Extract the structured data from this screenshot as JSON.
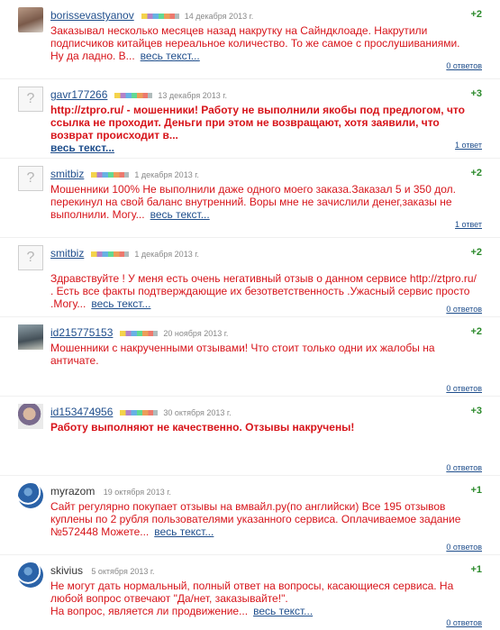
{
  "reviews": [
    {
      "author": "borissevastyanov",
      "date": "14 декабря 2013 г.",
      "score": "+2",
      "text": "Заказывал несколько месяцев назад накрутку на Сайндклоаде. Накрутили подписчиков китайцев нереальное количество. То же самое с прослушиваниями.",
      "text2": "Ну да ладно. В...",
      "more": "весь текст...",
      "answers": "0 ответов"
    },
    {
      "author": "gavr177266",
      "date": "13 декабря 2013 г.",
      "score": "+3",
      "text": "http://ztpro.ru/ - мошенники! Работу не выполнили якобы под предлогом, что ссылка не проходит. Деньги при этом не возвращают, хотя заявили, что возврат происходит в...",
      "more": "весь текст...",
      "answers": "1 ответ"
    },
    {
      "author": "smitbiz",
      "date": "1 декабря 2013 г.",
      "score": "+2",
      "text": "Мошенники 100% Не выполнили даже одного моего заказа.Заказал 5 и 350 дол. перекинул на свой баланс внутренний. Воры мне не зачислили денег,заказы не выполнили. Могу...",
      "more": "весь текст...",
      "answers": "1 ответ"
    },
    {
      "author": "smitbiz",
      "date": "1 декабря 2013 г.",
      "score": "+2",
      "text": "Здравствуйте ! У меня есть очень негативный отзыв о данном сервисе http://ztpro.ru/ . Есть все факты подтверждающие их безответственность .Ужасный сервис просто .Могу...",
      "more": "весь текст...",
      "answers": "0 ответов"
    },
    {
      "author": "id215775153",
      "date": "20 ноября 2013 г.",
      "score": "+2",
      "text": "Мошенники с накрученными отзывами! Что стоит только одни их жалобы на античате.",
      "answers": "0 ответов"
    },
    {
      "author": "id153474956",
      "date": "30 октября 2013 г.",
      "score": "+3",
      "text": "Работу выполняют не качественно. Отзывы накручены!",
      "answers": "0 ответов"
    },
    {
      "author": "myrazom",
      "date": "19 октября 2013 г.",
      "score": "+1",
      "text": "Сайт регулярно покупает отзывы на вмвайл.ру(по английски) Все 195 отзывов куплены по 2 рубля пользователями указанного сервиса. Оплачиваемое задание №572448 Можете...",
      "more": "весь текст...",
      "answers": "0 ответов"
    },
    {
      "author": "skivius",
      "date": "5 октября 2013 г.",
      "score": "+1",
      "text": "Не могут дать нормальный, полный ответ на вопросы, касающиеся сервиса. На любой вопрос отвечают \"Да/нет, заказывайте!\".",
      "text2": "На вопрос, является ли продвижение...",
      "more": "весь текст...",
      "answers": "0 ответов"
    }
  ]
}
